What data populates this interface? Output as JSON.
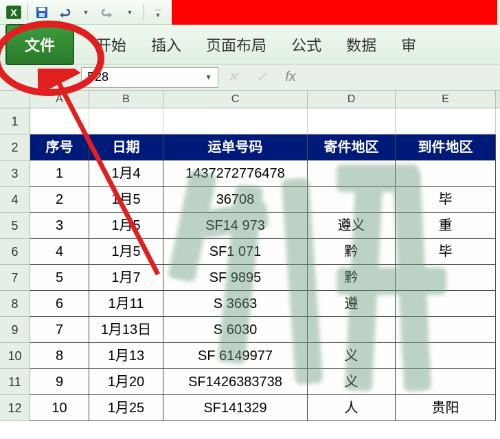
{
  "qat": {
    "save": "save-icon",
    "undo": "undo-icon",
    "redo": "redo-icon",
    "customize": "customize-icon"
  },
  "ribbon": {
    "file": "文件",
    "tabs": [
      "开始",
      "插入",
      "页面布局",
      "公式",
      "数据",
      "审"
    ]
  },
  "namebox": {
    "value": "F28"
  },
  "formula": {
    "fx": "fx",
    "value": ""
  },
  "columns": [
    "A",
    "B",
    "C",
    "D",
    "E"
  ],
  "row_numbers": [
    "1",
    "2",
    "3",
    "4",
    "5",
    "6",
    "7",
    "8",
    "9",
    "10",
    "11",
    "12"
  ],
  "headers": {
    "A": "序号",
    "B": "日期",
    "C": "运单号码",
    "D": "寄件地区",
    "E": "到件地区"
  },
  "rows": [
    {
      "A": "1",
      "B": "1月4",
      "C": "1437272776478",
      "D": "",
      "E": ""
    },
    {
      "A": "2",
      "B": "1月5",
      "C": "36708",
      "D": "",
      "E": "毕"
    },
    {
      "A": "3",
      "B": "1月5",
      "C": "SF14     973",
      "D": "遵义",
      "E": "重"
    },
    {
      "A": "4",
      "B": "1月5",
      "C": "SF1      071",
      "D": "黔",
      "E": "毕"
    },
    {
      "A": "5",
      "B": "1月7",
      "C": "SF       9895",
      "D": "黔",
      "E": ""
    },
    {
      "A": "6",
      "B": "1月11",
      "C": "S        3663",
      "D": "遵",
      "E": ""
    },
    {
      "A": "7",
      "B": "1月13日",
      "C": "S      6030",
      "D": "",
      "E": ""
    },
    {
      "A": "8",
      "B": "1月13",
      "C": "SF   6149977",
      "D": "义",
      "E": ""
    },
    {
      "A": "9",
      "B": "1月20",
      "C": "SF1426383738",
      "D": "义",
      "E": ""
    },
    {
      "A": "10",
      "B": "1月25",
      "C": "SF141329",
      "D": "人",
      "E": "贵阳"
    }
  ]
}
